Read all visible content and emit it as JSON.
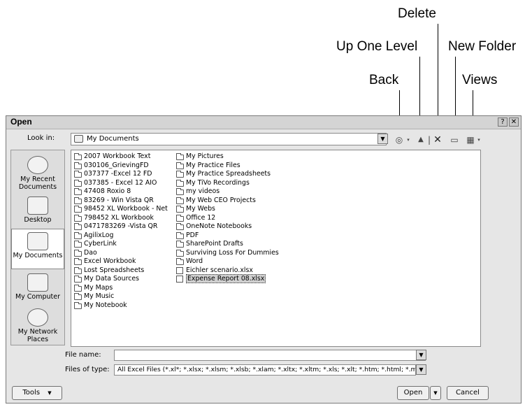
{
  "callouts": {
    "delete": "Delete",
    "up_one_level": "Up One Level",
    "new_folder": "New Folder",
    "back": "Back",
    "views": "Views"
  },
  "dialog": {
    "title": "Open",
    "help_button": "?",
    "close_button": "✕",
    "look_in_label": "Look in:",
    "look_in_value": "My Documents",
    "toolbar": {
      "back_glyph": "◎",
      "up_glyph": "▲",
      "delete_glyph": "✕",
      "new_folder_glyph": "▭",
      "views_glyph": "▦"
    },
    "places": [
      {
        "label": "My Recent Documents",
        "icon": "clock-icon"
      },
      {
        "label": "Desktop",
        "icon": "desktop-icon"
      },
      {
        "label": "My Documents",
        "icon": "documents-icon",
        "selected": true
      },
      {
        "label": "My Computer",
        "icon": "computer-icon"
      },
      {
        "label": "My Network Places",
        "icon": "globe-icon"
      }
    ],
    "files_col1": [
      "2007 Workbook Text",
      "030106_GrievingFD",
      "037377 -Excel 12 FD",
      "037385 - Excel 12 AIO",
      "47408 Roxio 8",
      "83269 - Win Vista QR",
      "98452 XL Workbook - Net",
      "798452 XL Workbook",
      "0471783269 -Vista QR",
      "AgilixLog",
      "CyberLink",
      "Dao",
      "Excel Workbook",
      "Lost Spreadsheets",
      "My Data Sources",
      "My Maps",
      "My Music",
      "My Notebook"
    ],
    "files_col2": [
      "My Pictures",
      "My Practice Files",
      "My Practice Spreadsheets",
      "My TiVo Recordings",
      "my videos",
      "My Web CEO Projects",
      "My Webs",
      "Office 12",
      "OneNote Notebooks",
      "PDF",
      "SharePoint Drafts",
      "Surviving Loss For Dummies",
      "Word",
      "Eichler scenario.xlsx",
      "Expense Report 08.xlsx"
    ],
    "file_name_label": "File name:",
    "file_name_value": "",
    "files_of_type_label": "Files of type:",
    "files_of_type_value": "All Excel Files (*.xl*; *.xlsx; *.xlsm; *.xlsb; *.xlam; *.xltx; *.xltm; *.xls; *.xlt; *.htm; *.html; *.mht; *",
    "tools_button": "Tools",
    "open_button": "Open",
    "cancel_button": "Cancel"
  }
}
